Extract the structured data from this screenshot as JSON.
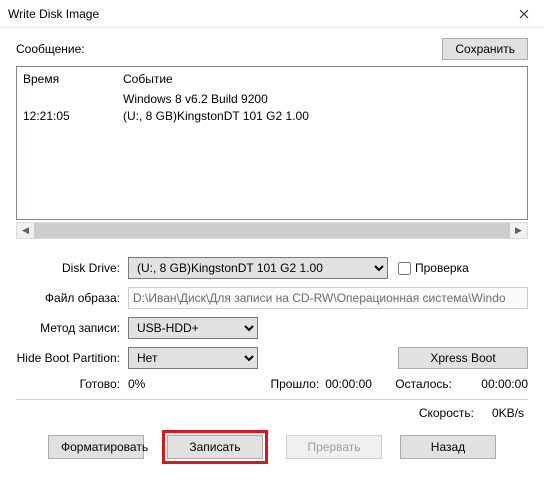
{
  "window": {
    "title": "Write Disk Image"
  },
  "message": {
    "label": "Сообщение:",
    "save_btn": "Сохранить"
  },
  "log": {
    "header_time": "Время",
    "header_event": "Событие",
    "rows": [
      {
        "time": "",
        "event": "Windows 8 v6.2 Build 9200"
      },
      {
        "time": "12:21:05",
        "event": "(U:, 8 GB)KingstonDT 101 G2      1.00"
      }
    ]
  },
  "form": {
    "drive_label": "Disk Drive:",
    "drive_value": "(U:, 8 GB)KingstonDT 101 G2      1.00",
    "verify_label": "Проверка",
    "image_label": "Файл образа:",
    "image_value": "D:\\Иван\\Диск\\Для записи на CD-RW\\Операционная система\\Windo",
    "method_label": "Метод записи:",
    "method_value": "USB-HDD+",
    "hide_label": "Hide Boot Partition:",
    "hide_value": "Нет",
    "xpress_btn": "Xpress Boot"
  },
  "status": {
    "ready_label": "Готово:",
    "ready_value": "0%",
    "elapsed_label": "Прошло:",
    "elapsed_value": "00:00:00",
    "remain_label": "Осталось:",
    "remain_value": "00:00:00"
  },
  "speed": {
    "label": "Скорость:",
    "value": "0KB/s"
  },
  "buttons": {
    "format": "Форматировать",
    "write": "Записать",
    "abort": "Прервать",
    "back": "Назад"
  }
}
